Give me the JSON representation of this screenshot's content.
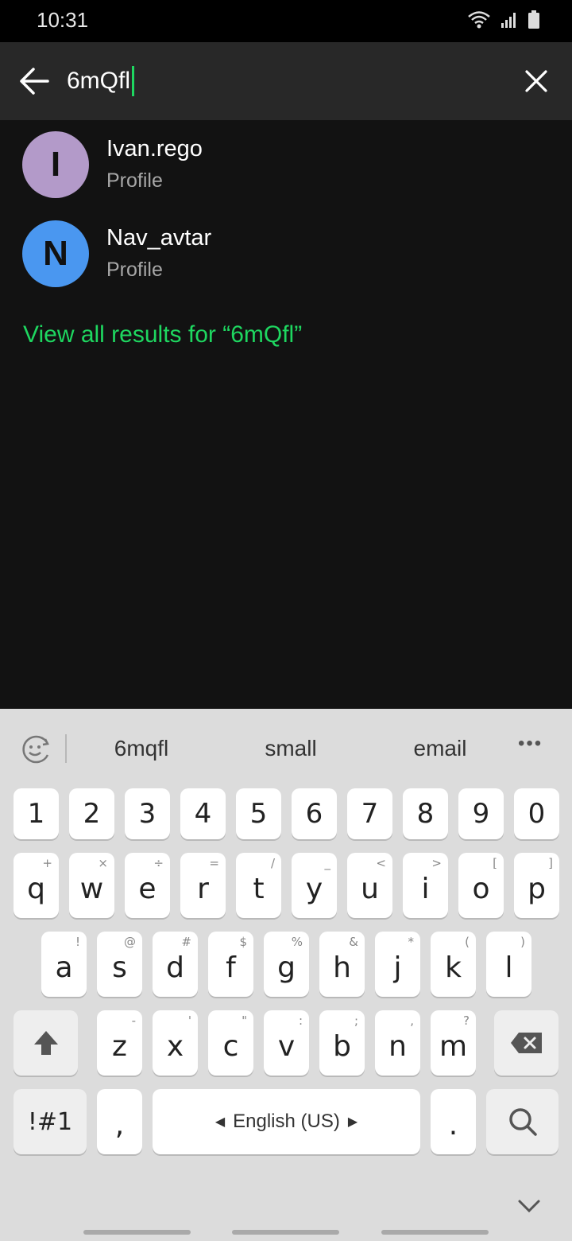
{
  "status": {
    "time": "10:31"
  },
  "search": {
    "query": "6mQfl"
  },
  "results": [
    {
      "initial": "I",
      "name": "Ivan.rego",
      "type": "Profile",
      "color": "#b39ac9"
    },
    {
      "initial": "N",
      "name": "Nav_avtar",
      "type": "Profile",
      "color": "#4a97f0"
    }
  ],
  "view_all": "View all results for “6mQfl”",
  "keyboard": {
    "suggestions": [
      "6mqfl",
      "small",
      "email"
    ],
    "more": "•••",
    "numbers": [
      "1",
      "2",
      "3",
      "4",
      "5",
      "6",
      "7",
      "8",
      "9",
      "0"
    ],
    "row1": [
      {
        "k": "q",
        "h": "+"
      },
      {
        "k": "w",
        "h": "×"
      },
      {
        "k": "e",
        "h": "÷"
      },
      {
        "k": "r",
        "h": "="
      },
      {
        "k": "t",
        "h": "/"
      },
      {
        "k": "y",
        "h": "_"
      },
      {
        "k": "u",
        "h": "<"
      },
      {
        "k": "i",
        "h": ">"
      },
      {
        "k": "o",
        "h": "["
      },
      {
        "k": "p",
        "h": "]"
      }
    ],
    "row2": [
      {
        "k": "a",
        "h": "!"
      },
      {
        "k": "s",
        "h": "@"
      },
      {
        "k": "d",
        "h": "#"
      },
      {
        "k": "f",
        "h": "$"
      },
      {
        "k": "g",
        "h": "%"
      },
      {
        "k": "h",
        "h": "&"
      },
      {
        "k": "j",
        "h": "*"
      },
      {
        "k": "k",
        "h": "("
      },
      {
        "k": "l",
        "h": ")"
      }
    ],
    "row3": [
      {
        "k": "z",
        "h": "-"
      },
      {
        "k": "x",
        "h": "'"
      },
      {
        "k": "c",
        "h": "\""
      },
      {
        "k": "v",
        "h": ":"
      },
      {
        "k": "b",
        "h": ";"
      },
      {
        "k": "n",
        "h": ","
      },
      {
        "k": "m",
        "h": "?"
      }
    ],
    "symbols_label": "!#1",
    "comma": ",",
    "space_label": "English (US)",
    "period": "."
  }
}
